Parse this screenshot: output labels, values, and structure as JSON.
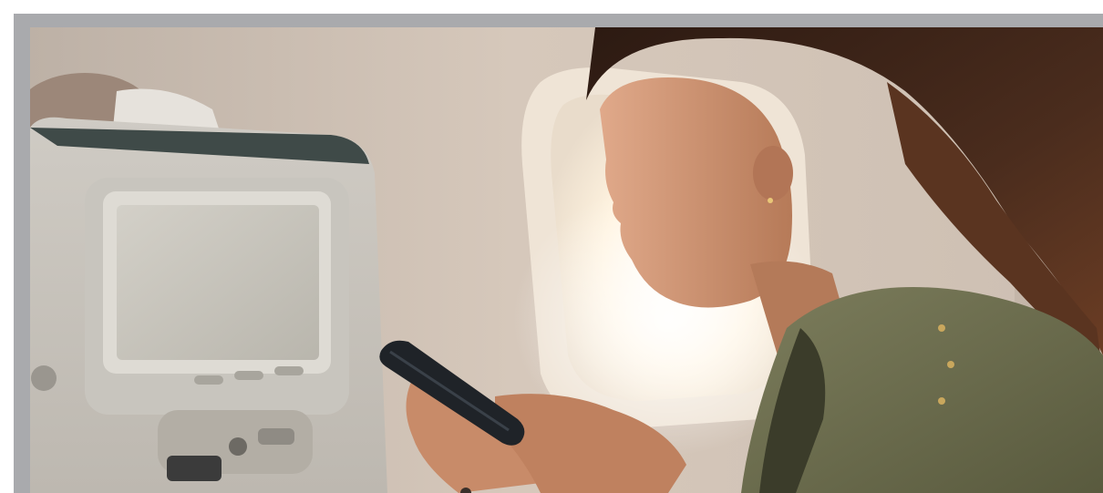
{
  "image": {
    "kind": "photograph",
    "subject": "passenger-using-smartphone-on-airplane",
    "colors": {
      "frame": "#a9aaad",
      "cabin_wall": "#cdbfb2",
      "window_glow": "#fff6e6",
      "seatback": "#d6d3cd",
      "screen": "#c7c4bc",
      "hair": "#3a241a",
      "skin": "#c98d6a",
      "jacket": "#6a6b4b"
    }
  }
}
